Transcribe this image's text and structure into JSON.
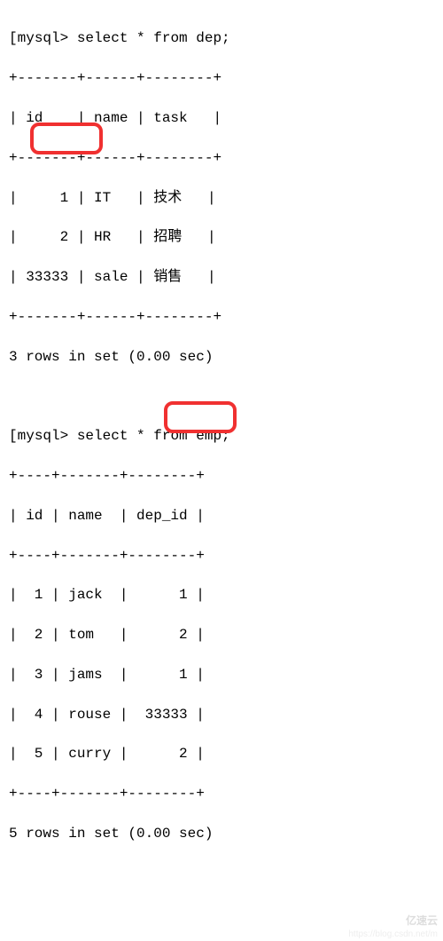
{
  "prompt_label": "mysql>",
  "query1": {
    "command": "select * from dep;",
    "border_top": "+-------+------+--------+",
    "header": "| id    | name | task   |",
    "rows": [
      "|     1 | IT   | 技术   |",
      "|     2 | HR   | 招聘   |",
      "| 33333 | sale | 销售   |"
    ],
    "footer": "3 rows in set (0.00 sec)"
  },
  "query2": {
    "command": "select * from emp;",
    "border_top": "+----+-------+--------+",
    "header": "| id | name  | dep_id |",
    "rows": [
      "|  1 | jack  |      1 |",
      "|  2 | tom   |      2 |",
      "|  3 | jams  |      1 |",
      "|  4 | rouse |  33333 |",
      "|  5 | curry |      2 |"
    ],
    "footer": "5 rows in set (0.00 sec)"
  },
  "highlight_value_1": "33333",
  "highlight_value_2": "33333",
  "watermark": "亿速云",
  "watermark_url": "https://blog.csdn.net/m",
  "chart_data": [
    {
      "type": "table",
      "title": "dep",
      "columns": [
        "id",
        "name",
        "task"
      ],
      "rows": [
        {
          "id": 1,
          "name": "IT",
          "task": "技术"
        },
        {
          "id": 2,
          "name": "HR",
          "task": "招聘"
        },
        {
          "id": 33333,
          "name": "sale",
          "task": "销售"
        }
      ]
    },
    {
      "type": "table",
      "title": "emp",
      "columns": [
        "id",
        "name",
        "dep_id"
      ],
      "rows": [
        {
          "id": 1,
          "name": "jack",
          "dep_id": 1
        },
        {
          "id": 2,
          "name": "tom",
          "dep_id": 2
        },
        {
          "id": 3,
          "name": "jams",
          "dep_id": 1
        },
        {
          "id": 4,
          "name": "rouse",
          "dep_id": 33333
        },
        {
          "id": 5,
          "name": "curry",
          "dep_id": 2
        }
      ]
    }
  ]
}
